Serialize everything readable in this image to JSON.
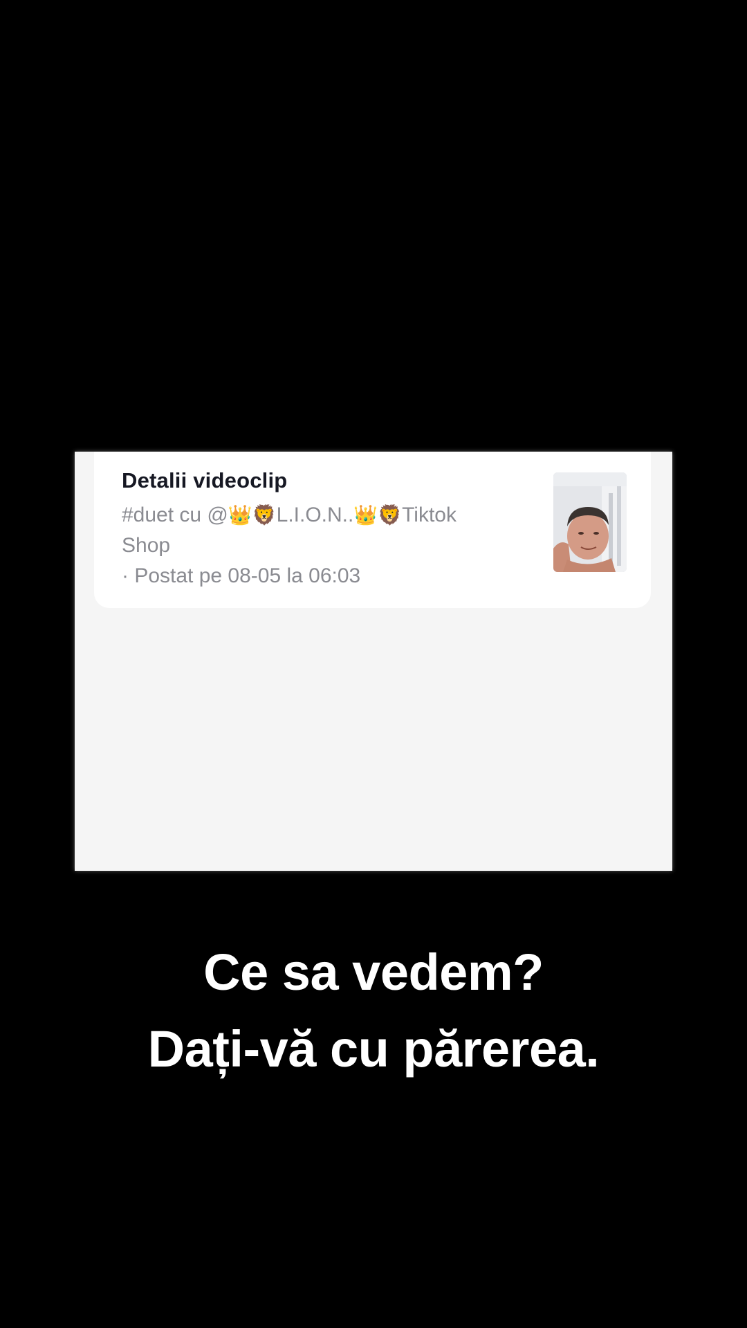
{
  "video_details": {
    "title": "Detalii videoclip",
    "caption_line_1_prefix": "#duet cu @",
    "caption_emoji_crown": "👑",
    "caption_emoji_lion": "🦁",
    "caption_user": "L.I.O.N..",
    "caption_suffix": "Tiktok",
    "caption_line_2": "Shop",
    "posted": "· Postat pe 08-05 la 06:03",
    "thumbnail_icon": "person-face-thumbnail"
  },
  "overlay": {
    "line_1": "Ce sa vedem?",
    "line_2": "Dați-vă cu părerea."
  },
  "colors": {
    "background": "#000000",
    "panel": "#f5f5f5",
    "card": "#ffffff",
    "title": "#161823",
    "caption": "#8a8b91",
    "overlay_text": "#ffffff"
  }
}
